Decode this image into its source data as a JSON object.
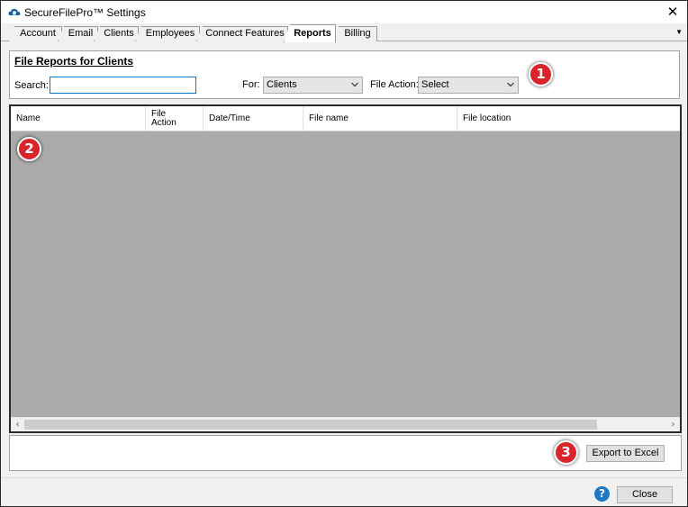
{
  "window": {
    "title": "SecureFilePro™ Settings",
    "close_glyph": "✕"
  },
  "tabs": [
    {
      "label": "Account",
      "active": false
    },
    {
      "label": "Email",
      "active": false
    },
    {
      "label": "Clients",
      "active": false
    },
    {
      "label": "Employees",
      "active": false
    },
    {
      "label": "Connect Features",
      "active": false
    },
    {
      "label": "Reports",
      "active": true
    },
    {
      "label": "Billing",
      "active": false
    }
  ],
  "tab_overflow_glyph": "▼",
  "filters": {
    "title": "File Reports for Clients",
    "search_label": "Search:",
    "search_value": "",
    "for_label": "For:",
    "for_value": "Clients",
    "file_action_label": "File Action:",
    "file_action_value": "Select"
  },
  "grid": {
    "columns": [
      "Name",
      "File\nAction",
      "Date/Time",
      "File name",
      "File location"
    ],
    "rows": []
  },
  "buttons": {
    "export": "Export to Excel",
    "close": "Close"
  },
  "help_glyph": "?",
  "callouts": [
    "1",
    "2",
    "3"
  ],
  "colors": {
    "callout": "#d8242a",
    "grid_background": "#ababab",
    "help": "#1c79c6"
  }
}
